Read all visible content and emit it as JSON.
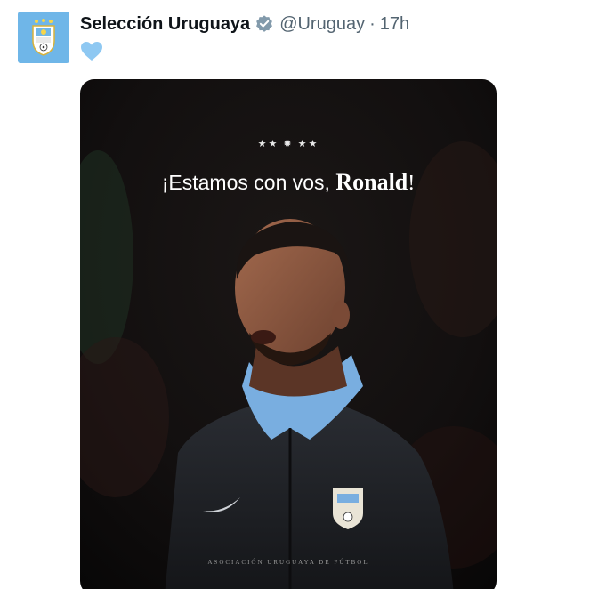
{
  "tweet": {
    "author": {
      "display_name": "Selección Uruguaya",
      "handle": "@Uruguay",
      "verified": true,
      "avatar_icon": "uruguay-crest-icon",
      "avatar_color": "#6fb6e8"
    },
    "separator": "·",
    "time": "17h",
    "body_emoji": "light-blue-heart",
    "heart_color": "#8ec8f2",
    "media": {
      "stars": "★★ ✹ ★★",
      "headline_prefix": "¡Estamos con vos, ",
      "headline_name": "Ronald",
      "headline_suffix": "!",
      "footer": "ASOCIACIÓN URUGUAYA DE FÚTBOL"
    }
  }
}
